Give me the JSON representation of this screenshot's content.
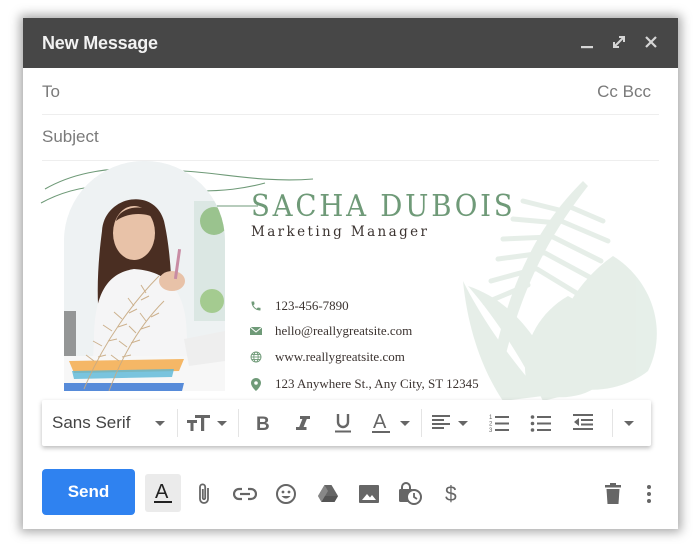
{
  "window": {
    "title": "New Message",
    "controls": [
      "minimize-icon",
      "expand-icon",
      "close-icon"
    ]
  },
  "to": {
    "label": "To",
    "value": "",
    "cc_bcc": "Cc Bcc"
  },
  "subject": {
    "placeholder": "Subject",
    "value": ""
  },
  "signature": {
    "name": "SACHA DUBOIS",
    "role": "Marketing Manager",
    "phone": "123-456-7890",
    "email": "hello@reallygreatsite.com",
    "website": "www.reallygreatsite.com",
    "address": "123 Anywhere St., Any City, ST 12345",
    "accent_color": "#6f9a78"
  },
  "format_toolbar": {
    "font": "Sans Serif",
    "buttons": [
      "font-size",
      "bold",
      "italic",
      "underline",
      "text-color",
      "align",
      "numbered-list",
      "bulleted-list",
      "indent-less",
      "more-formatting"
    ]
  },
  "bottom_bar": {
    "send_label": "Send",
    "send_color": "#2f82f0",
    "icons": [
      "formatting-options",
      "attach-file",
      "insert-link",
      "insert-emoji",
      "google-drive",
      "insert-photo",
      "confidential-mode",
      "insert-money",
      "discard-draft",
      "more-options"
    ]
  }
}
